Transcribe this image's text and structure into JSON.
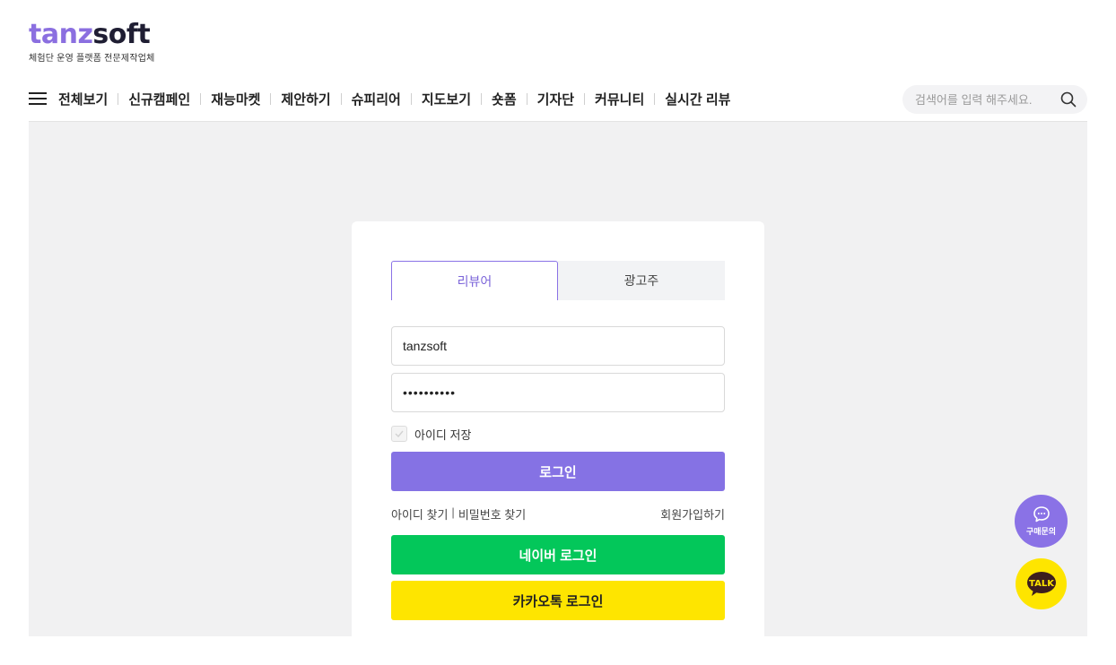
{
  "logo": {
    "part1": "tanz",
    "part2": "soft",
    "tagline": "체험단 운영 플랫폼 전문제작업체",
    "colors": {
      "accent": "#8b6fe0",
      "dark": "#1f1e33"
    }
  },
  "nav": {
    "items": [
      {
        "label": "전체보기"
      },
      {
        "label": "신규캠페인"
      },
      {
        "label": "재능마켓"
      },
      {
        "label": "제안하기"
      },
      {
        "label": "슈피리어"
      },
      {
        "label": "지도보기"
      },
      {
        "label": "숏폼"
      },
      {
        "label": "기자단"
      },
      {
        "label": "커뮤니티"
      },
      {
        "label": "실시간 리뷰"
      }
    ],
    "menu_icon": "hamburger-icon"
  },
  "search": {
    "placeholder": "검색어를 입력 해주세요.",
    "icon": "search-icon"
  },
  "login": {
    "tabs": [
      {
        "label": "리뷰어",
        "active": true
      },
      {
        "label": "광고주",
        "active": false
      }
    ],
    "id_value": "tanzsoft",
    "password_value": "••••••••••",
    "remember_label": "아이디 저장",
    "submit_label": "로그인",
    "find_id": "아이디 찾기",
    "separator": "|",
    "find_password": "비밀번호 찾기",
    "signup": "회원가입하기",
    "naver_label": "네이버 로그인",
    "kakao_label": "카카오톡 로그인",
    "colors": {
      "primary": "#8572e4",
      "naver": "#03c75a",
      "kakao": "#fee500"
    }
  },
  "floating": {
    "inquiry_label": "구매문의",
    "inquiry_icon": "chat-bubble-icon",
    "talk_label": "TALK",
    "talk_icon": "kakao-talk-icon"
  }
}
